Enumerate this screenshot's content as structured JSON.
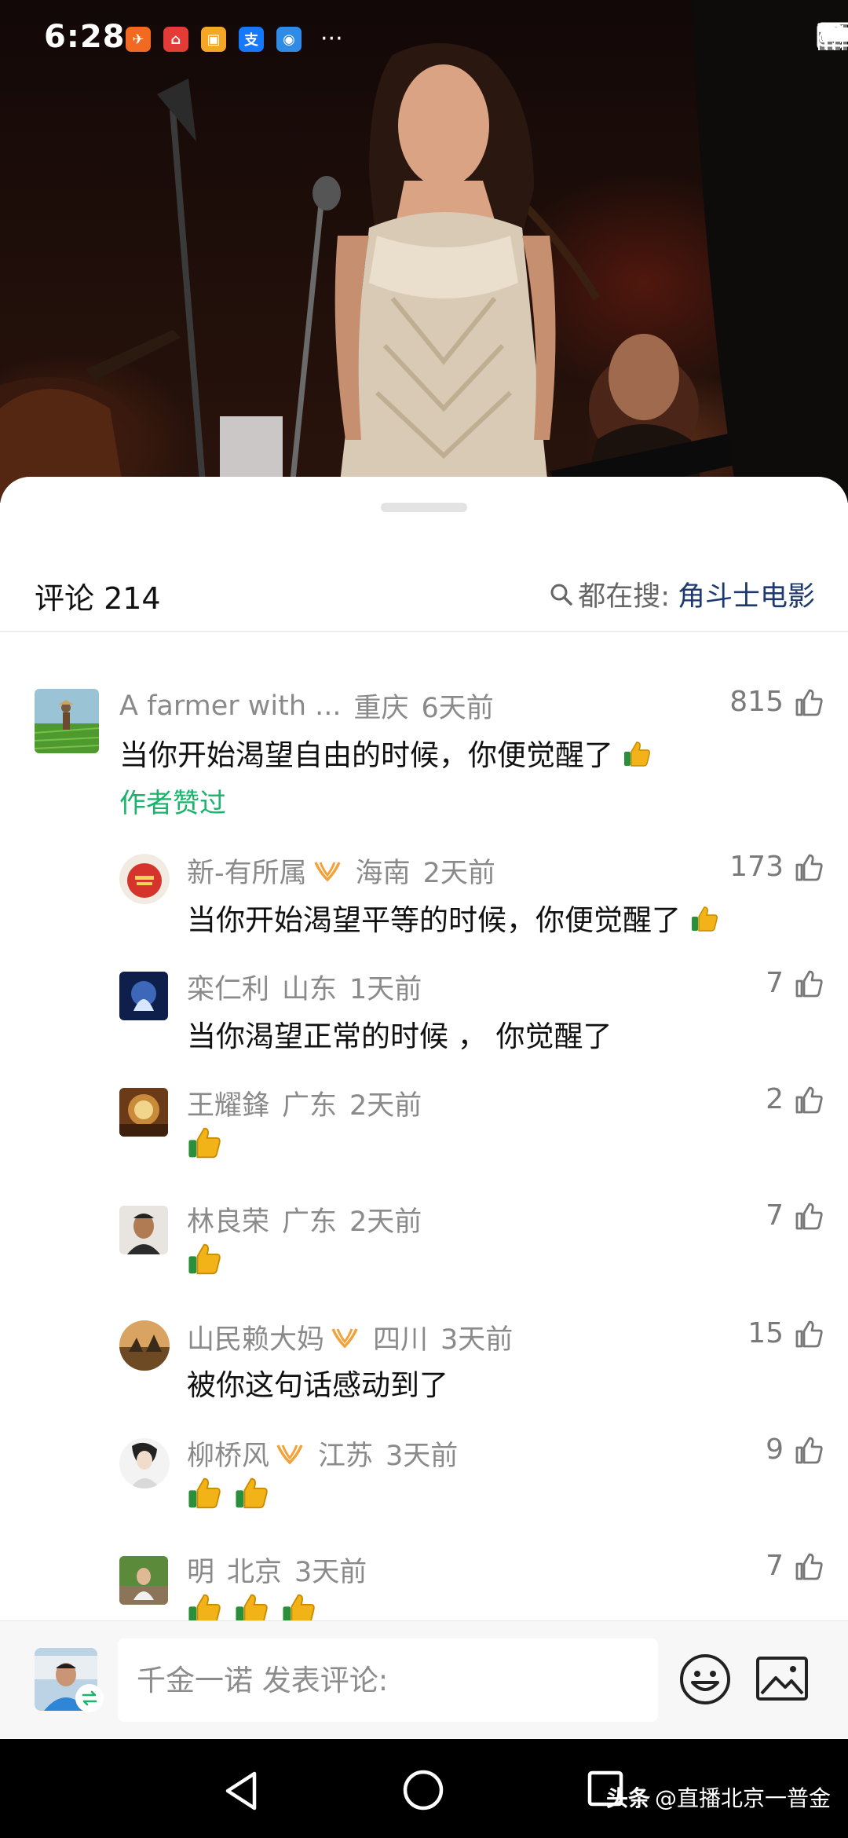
{
  "status_bar": {
    "time": "6:28",
    "app_icons": [
      {
        "name": "transfer-app-icon",
        "color": "#f26a21",
        "glyph": "✈"
      },
      {
        "name": "home-app-icon",
        "color": "#e33b36",
        "glyph": "⌂"
      },
      {
        "name": "wallet-app-icon",
        "color": "#f5a623",
        "glyph": "▣"
      },
      {
        "name": "alipay-app-icon",
        "color": "#1677ff",
        "glyph": "支"
      },
      {
        "name": "browser-app-icon",
        "color": "#2f8be6",
        "glyph": "◉"
      }
    ],
    "more": "···",
    "network": "4G"
  },
  "sheet": {
    "title": "评论 214",
    "search_label": "都在搜:",
    "search_term": "角斗士电影"
  },
  "colors": {
    "accent_green": "#19b36b",
    "search_term_blue": "#1d3a6e",
    "vip_badge": "#f3a23b"
  },
  "comments": [
    {
      "author": "A farmer with ...",
      "location": "重庆",
      "time": "6天前",
      "text": "当你开始渴望自由的时候，你便觉醒了",
      "thumb_emojis": 1,
      "likes": "815",
      "author_liked": "作者赞过",
      "vip": false
    },
    {
      "author": "新-有所属",
      "location": "海南",
      "time": "2天前",
      "text": "当你开始渴望平等的时候，你便觉醒了",
      "thumb_emojis": 1,
      "likes": "173",
      "vip": true
    },
    {
      "author": "栾仁利",
      "location": "山东",
      "time": "1天前",
      "text": "当你渴望正常的时候 ， 你觉醒了",
      "thumb_emojis": 0,
      "likes": "7",
      "vip": false
    },
    {
      "author": "王耀鋒",
      "location": "广东",
      "time": "2天前",
      "text": "",
      "thumb_emojis": 1,
      "likes": "2",
      "vip": false
    },
    {
      "author": "林良荣",
      "location": "广东",
      "time": "2天前",
      "text": "",
      "thumb_emojis": 1,
      "likes": "7",
      "vip": false
    },
    {
      "author": "山民赖大妈",
      "location": "四川",
      "time": "3天前",
      "text": "被你这句话感动到了",
      "thumb_emojis": 0,
      "likes": "15",
      "vip": true
    },
    {
      "author": "柳桥风",
      "location": "江苏",
      "time": "3天前",
      "text": "",
      "thumb_emojis": 2,
      "likes": "9",
      "vip": true
    },
    {
      "author": "明",
      "location": "北京",
      "time": "3天前",
      "text": "",
      "thumb_emojis": 3,
      "likes": "7",
      "vip": false
    }
  ],
  "input_bar": {
    "placeholder": "千金一诺 发表评论:",
    "emoji_icon": "smiley-icon",
    "image_icon": "image-icon"
  },
  "nav": {
    "watermark_brand": "头条",
    "watermark_handle": "@直播北京一普金"
  }
}
